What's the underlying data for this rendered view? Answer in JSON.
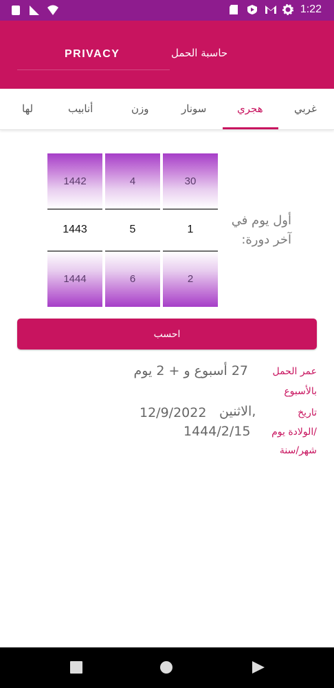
{
  "status_bar": {
    "time": "1:22",
    "icons": [
      "signal-icon",
      "cellular-icon",
      "wifi-icon",
      "sd-card-icon",
      "play-protect-icon",
      "gmail-icon",
      "settings-gear-icon"
    ]
  },
  "app_bar": {
    "privacy_label": "PRIVACY",
    "title": "حاسبة الحمل"
  },
  "tabs": [
    {
      "label": "غربي"
    },
    {
      "label": "هجري",
      "active": true
    },
    {
      "label": "سونار"
    },
    {
      "label": "وزن"
    },
    {
      "label": "أنابيب"
    },
    {
      "label": "لها"
    }
  ],
  "pickers": {
    "label": "أول يوم في آخر دورة:",
    "day": {
      "prev": "30",
      "current": "1",
      "next": "2"
    },
    "month": {
      "prev": "4",
      "current": "5",
      "next": "6"
    },
    "year": {
      "prev": "1442",
      "current": "1443",
      "next": "1444"
    }
  },
  "calculate_button": {
    "label": "احسب"
  },
  "results": {
    "age_label_1": "عمر الحمل",
    "age_label_2": "بالأسبوع",
    "age_value": "27 أسبوع و  + 2  يوم",
    "date_label_1": "تاريخ",
    "date_label_2": "الولادة يوم/",
    "date_label_3": "شهر/سنة",
    "date_day_name": "الاثنين,",
    "date_gregorian": "12/9/2022",
    "date_hijri": "1444/2/15"
  },
  "colors": {
    "status_bar": "#8e1c8e",
    "primary": "#c8145f",
    "picker_gradient": "#a63ec8"
  }
}
